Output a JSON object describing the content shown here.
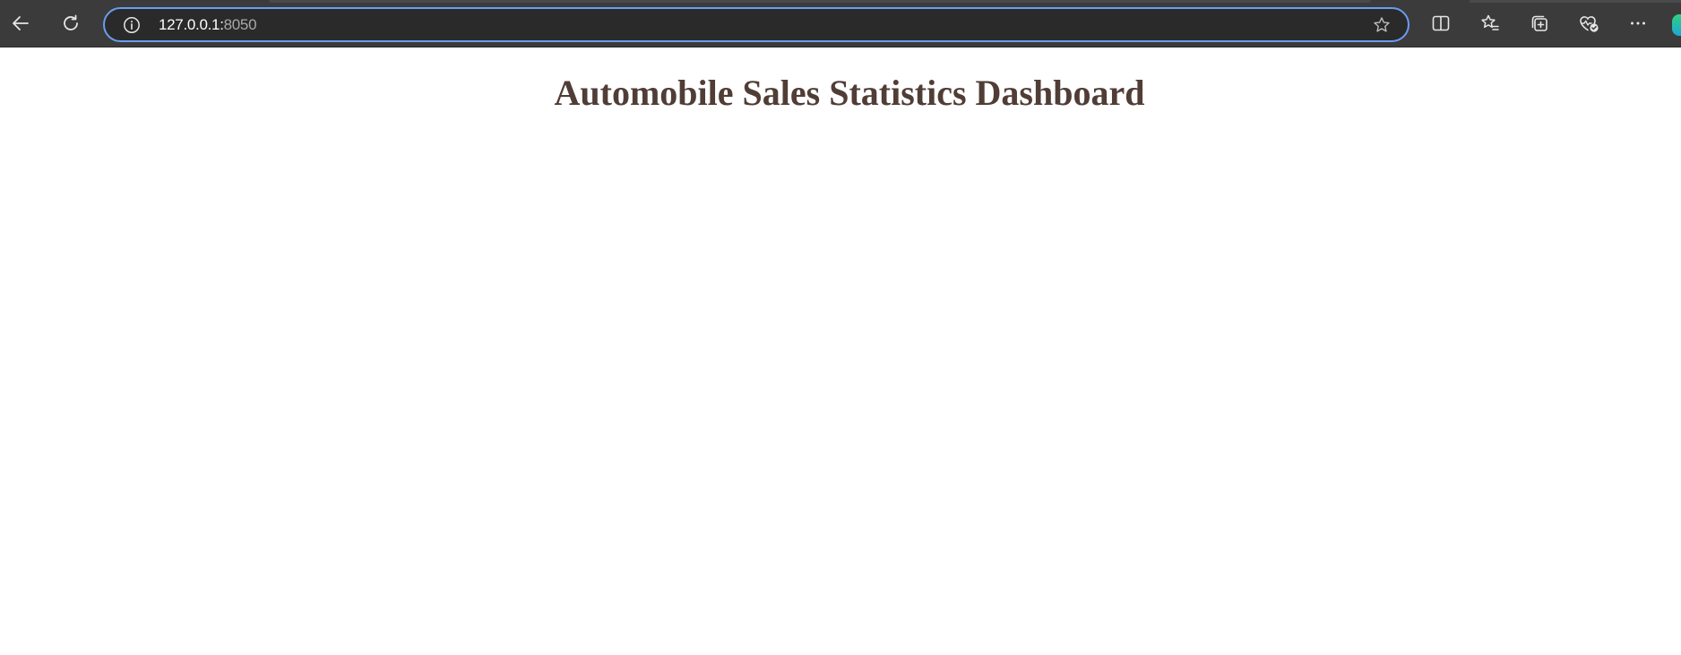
{
  "browser": {
    "url_host": "127.0.0.1:",
    "url_port": "8050",
    "icons": {
      "back": "arrow-left-icon",
      "refresh": "refresh-icon",
      "site_info": "info-circle-icon",
      "favorite": "star-outline-icon",
      "split_screen": "split-screen-icon",
      "favorites": "favorites-list-icon",
      "collections": "collections-icon",
      "performance": "heartbeat-check-icon",
      "more": "more-dots-icon"
    },
    "colors": {
      "toolbar": "#3b3b3b",
      "address_bar": "#2a2a2a",
      "address_border": "#6b9cf0"
    }
  },
  "page": {
    "title": "Automobile Sales Statistics Dashboard",
    "title_color": "#503d36"
  }
}
